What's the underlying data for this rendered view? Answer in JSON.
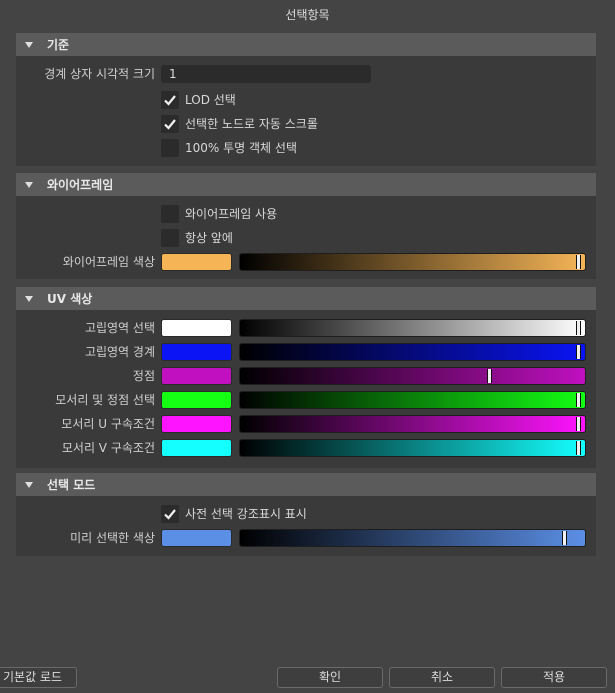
{
  "window": {
    "title": "선택항목"
  },
  "sections": {
    "basic": {
      "header": "기준",
      "bbox_label": "경계 상자 시각적 크기",
      "bbox_value": "1",
      "lod_label": "LOD 선택",
      "lod_checked": true,
      "autoscroll_label": "선택한 노드로 자동 스크롤",
      "autoscroll_checked": true,
      "transparent_label": "100% 투명 객체 선택",
      "transparent_checked": false
    },
    "wireframe": {
      "header": "와이어프레임",
      "use_label": "와이어프레임 사용",
      "use_checked": false,
      "front_label": "항상 앞에",
      "front_checked": false,
      "color_label": "와이어프레임 색상",
      "color": "#f5b557",
      "level": 0.99
    },
    "uv": {
      "header": "UV 색상",
      "rows": [
        {
          "label": "고립영역 선택",
          "color": "#ffffff",
          "level": 0.99
        },
        {
          "label": "고립영역 경계",
          "color": "#0a14f5",
          "level": 0.99
        },
        {
          "label": "정점",
          "color": "#c010c0",
          "level": 0.73
        },
        {
          "label": "모서리 및 정점 선택",
          "color": "#14ff14",
          "level": 0.99
        },
        {
          "label": "모서리 U 구속조건",
          "color": "#ff14ff",
          "level": 0.99
        },
        {
          "label": "모서리 V 구속조건",
          "color": "#14ffff",
          "level": 0.99
        }
      ]
    },
    "mode": {
      "header": "선택 모드",
      "preselect_label": "사전 선택 강조표시 표시",
      "preselect_checked": true,
      "presel_color_label": "미리 선택한 색상",
      "presel_color": "#5b8fe6",
      "level": 0.95
    }
  },
  "buttons": {
    "load_defaults": "기본값 로드",
    "ok": "확인",
    "cancel": "취소",
    "apply": "적용"
  },
  "colors": {
    "panel_bg": "#444444",
    "section_bg": "#3a3a3a",
    "header_bg": "#5b5b5b",
    "field_bg": "#2b2b2b"
  }
}
